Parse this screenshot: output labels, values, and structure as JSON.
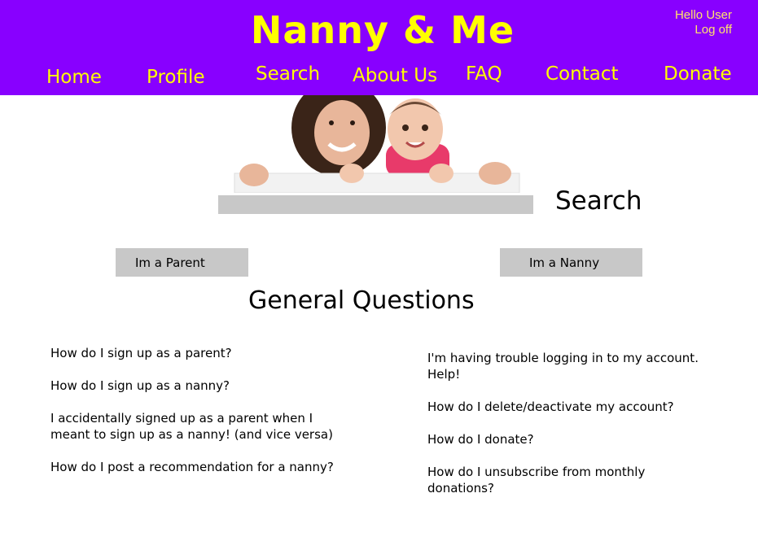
{
  "site": {
    "title": "Nanny & Me",
    "greeting": "Hello User",
    "logoff": "Log off",
    "colors": {
      "header_bg": "#8800ff",
      "accent": "#ffff00"
    }
  },
  "nav": [
    "Home",
    "Profile",
    "Search",
    "About Us",
    "FAQ",
    "Contact",
    "Donate"
  ],
  "search": {
    "value": "",
    "label": "Search"
  },
  "buttons": {
    "parent": "Im a Parent",
    "nanny": "Im a Nanny"
  },
  "section_title": "General Questions",
  "faq_left": [
    "How do I sign up as a parent?",
    "How do I sign up as a nanny?",
    "I accidentally signed up as a parent when I meant to sign up as a nanny! (and vice versa)",
    "How do I post a recommendation for a nanny?"
  ],
  "faq_right": [
    "I'm having trouble logging in to my account. Help!",
    "How do I delete/deactivate my account?",
    "How do I donate?",
    "How do I unsubscribe from monthly donations?"
  ]
}
